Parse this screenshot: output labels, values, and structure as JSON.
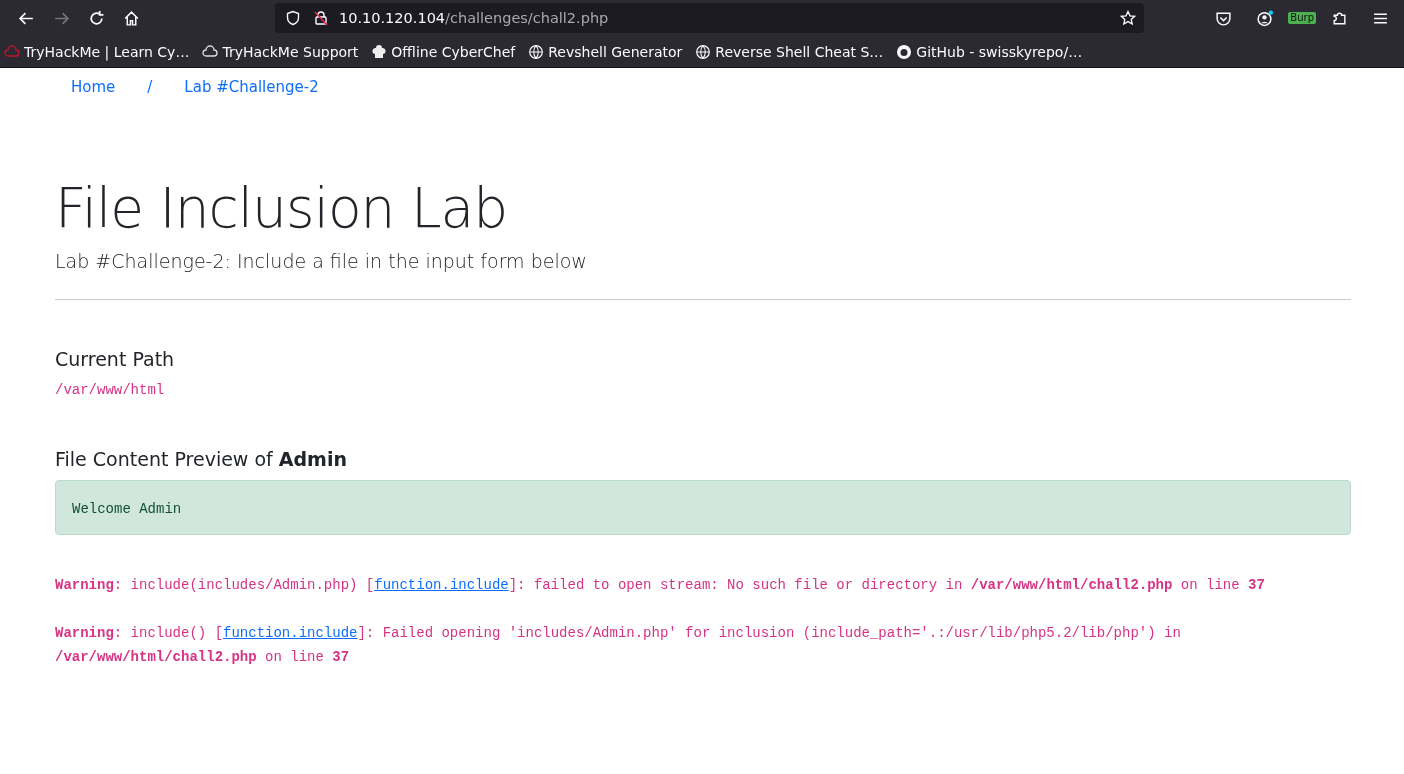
{
  "browser": {
    "url_host": "10.10.120.104",
    "url_path": "/challenges/chall2.php",
    "extension_badge": "Burp",
    "bookmarks": [
      {
        "label": "TryHackMe | Learn Cy…",
        "kind": "cloud"
      },
      {
        "label": "TryHackMe Support",
        "kind": "cloud"
      },
      {
        "label": "Offline CyberChef",
        "kind": "chef"
      },
      {
        "label": "Revshell Generator",
        "kind": "globe"
      },
      {
        "label": "Reverse Shell Cheat S…",
        "kind": "globe"
      },
      {
        "label": "GitHub - swisskyrepo/…",
        "kind": "github"
      }
    ]
  },
  "breadcrumb": {
    "items": [
      "Home",
      "Lab #Challenge-2"
    ],
    "separator": "/"
  },
  "title": "File Inclusion Lab",
  "subtitle": "Lab #Challenge-2: Include a file in the input form below",
  "current_path": {
    "heading": "Current Path",
    "value": "/var/www/html"
  },
  "preview": {
    "heading": "File Content Preview of **Admin**",
    "content": "Welcome Admin"
  },
  "warnings": [
    {
      "before": "**Warning**: include(includes/Admin.php) [",
      "link": "function.include",
      "after": "]: failed to open stream: No such file or directory in **/var/www/html/chall2.php** on line **37**"
    },
    {
      "before": "**Warning**: include() [",
      "link": "function.include",
      "after": "]: Failed opening 'includes/Admin.php' for inclusion (include_path='.:/usr/lib/php5.2/lib/php') in **/var/www/html/chall2.php** on line **37**"
    }
  ]
}
